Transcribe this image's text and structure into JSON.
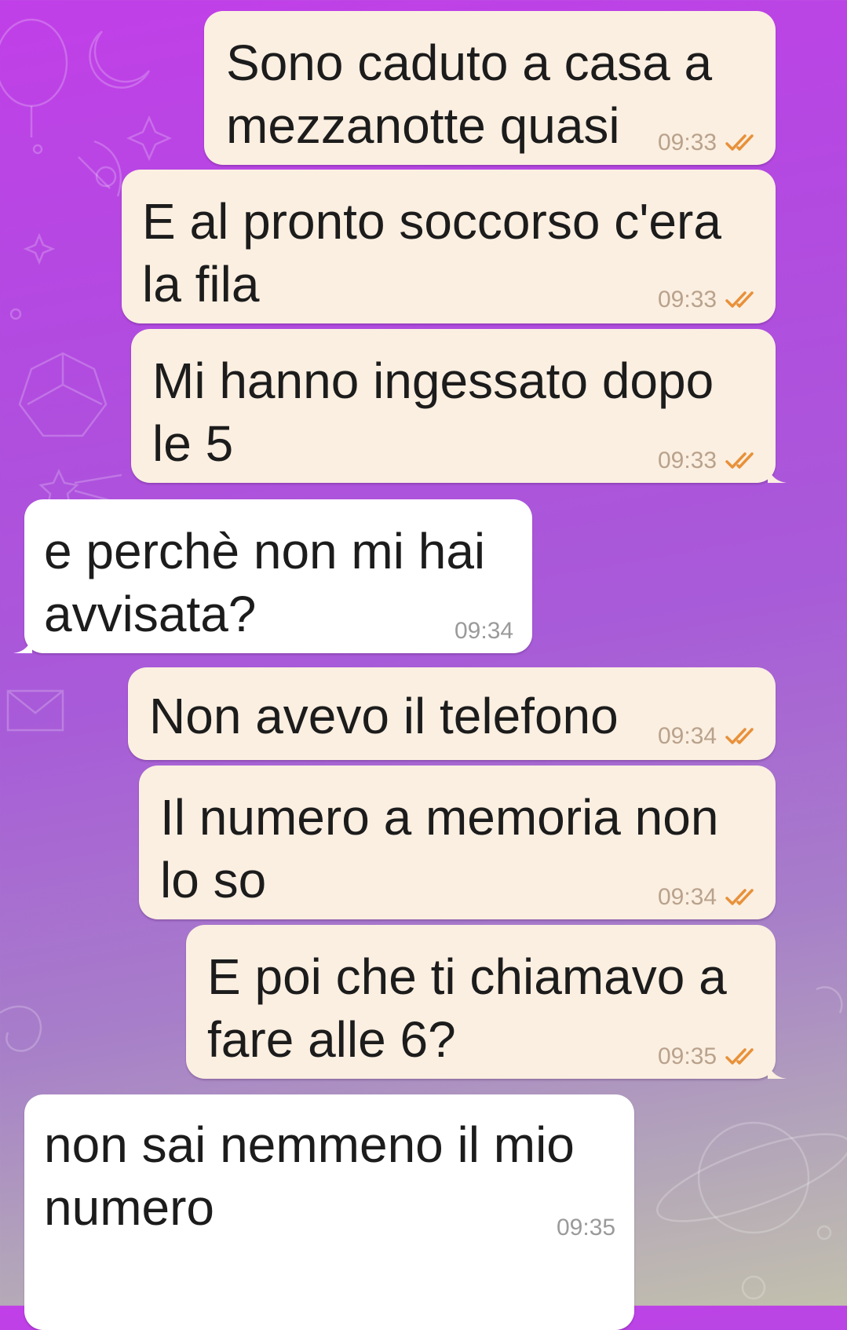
{
  "colors": {
    "outgoing_bubble": "#fbefe1",
    "incoming_bubble": "#ffffff",
    "read_check": "#e8913a"
  },
  "messages": [
    {
      "dir": "out",
      "lines": [
        "Sono caduto a casa a",
        "mezzanotte quasi"
      ],
      "time": "09:33",
      "status": "read"
    },
    {
      "dir": "out",
      "lines": [
        "E al pronto soccorso c'era",
        "la fila"
      ],
      "time": "09:33",
      "status": "read"
    },
    {
      "dir": "out",
      "lines": [
        "Mi hanno ingessato dopo",
        "le 5"
      ],
      "time": "09:33",
      "status": "read"
    },
    {
      "dir": "in",
      "lines": [
        "e perchè non mi hai",
        "avvisata?"
      ],
      "time": "09:34"
    },
    {
      "dir": "out",
      "lines": [
        "Non avevo il telefono"
      ],
      "time": "09:34",
      "status": "read"
    },
    {
      "dir": "out",
      "lines": [
        "Il numero a memoria non",
        "lo so"
      ],
      "time": "09:34",
      "status": "read"
    },
    {
      "dir": "out",
      "lines": [
        "E poi che ti chiamavo a",
        "fare alle 6?"
      ],
      "time": "09:35",
      "status": "read"
    },
    {
      "dir": "in",
      "lines": [
        "non sai nemmeno il mio",
        "numero"
      ],
      "time": "09:35"
    }
  ]
}
